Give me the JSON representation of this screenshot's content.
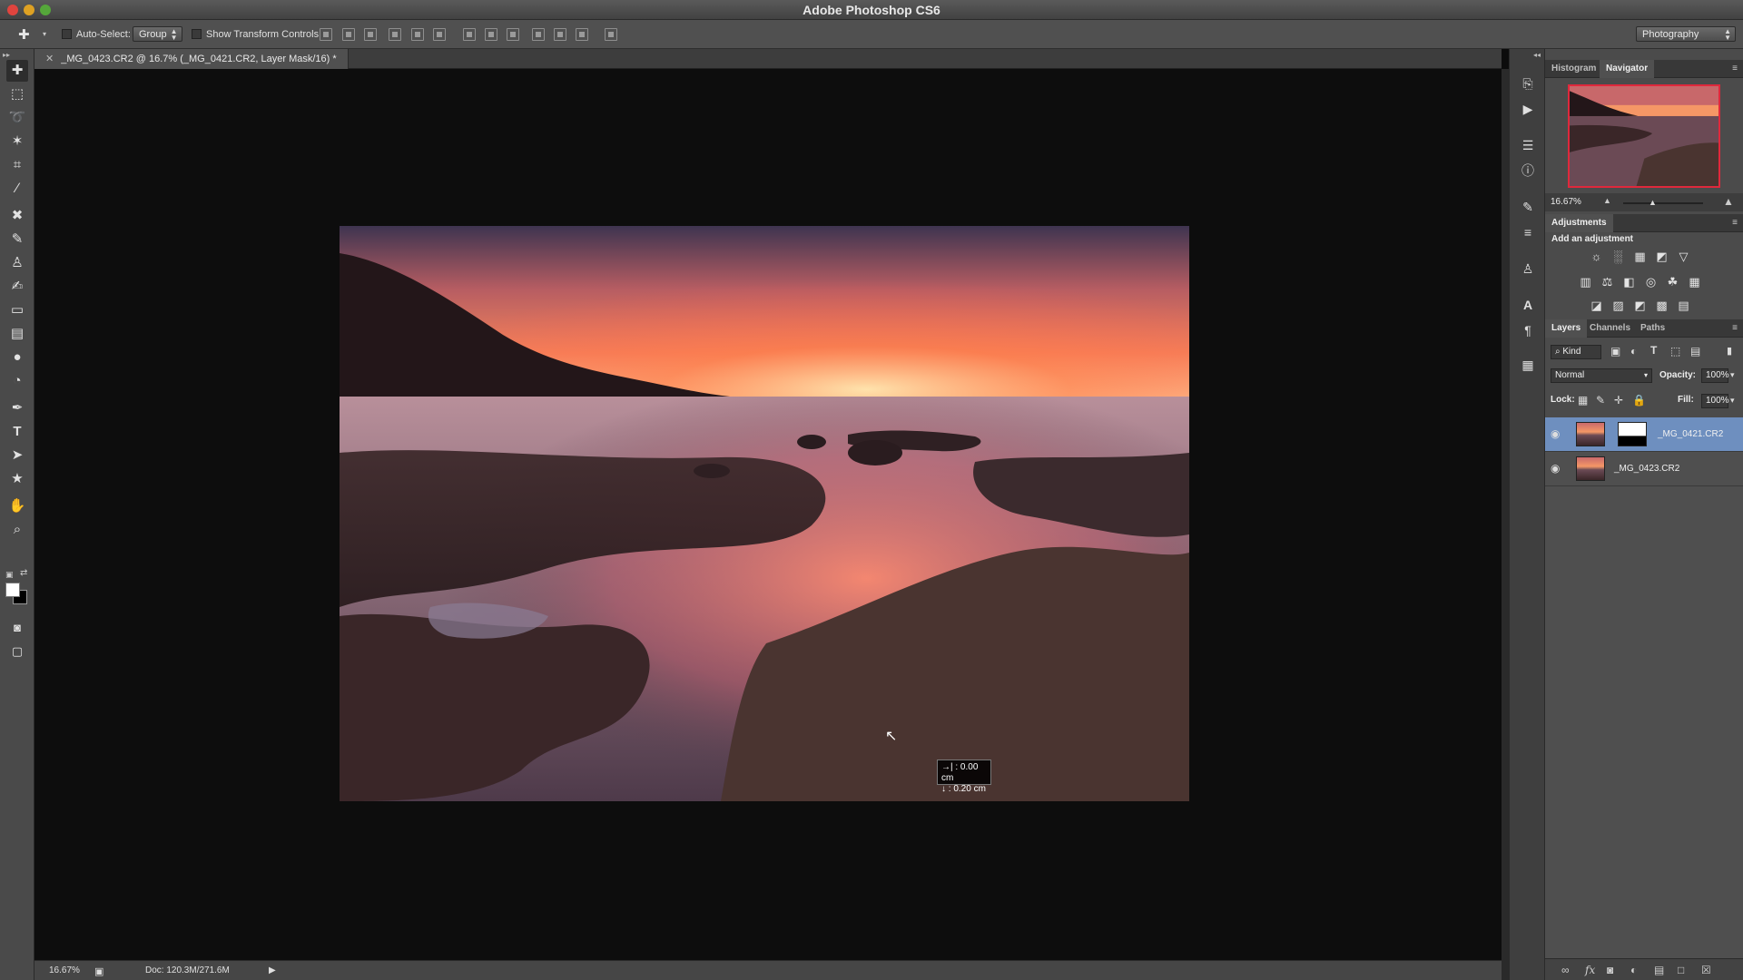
{
  "app": {
    "title": "Adobe Photoshop CS6"
  },
  "colors": {
    "accent_selected": "#6e8fbf",
    "panel": "#4b4b4b",
    "canvas": "#0d0d0d"
  },
  "options_bar": {
    "auto_select_label": "Auto-Select:",
    "auto_select_value": "Group",
    "show_transform_label": "Show Transform Controls",
    "workspace": "Photography"
  },
  "document": {
    "tab_label": "_MG_0423.CR2 @ 16.7% (_MG_0421.CR2, Layer Mask/16) *",
    "measure_x": "→| : 0.00 cm",
    "measure_y": "↓ : 0.20 cm"
  },
  "status_bar": {
    "zoom": "16.67%",
    "doc_size": "Doc: 120.3M/271.6M"
  },
  "tools": [
    "move-icon",
    "marquee-icon",
    "lasso-icon",
    "magic-wand-icon",
    "crop-icon",
    "eyedropper-icon",
    "healing-icon",
    "brush-icon",
    "stamp-icon",
    "history-brush-icon",
    "eraser-icon",
    "gradient-icon",
    "blur-icon",
    "dodge-icon",
    "pen-icon",
    "type-icon",
    "path-select-icon",
    "shape-icon",
    "hand-icon",
    "zoom-icon"
  ],
  "navigator": {
    "tab_histogram": "Histogram",
    "tab_navigator": "Navigator",
    "zoom": "16.67%"
  },
  "adjustments": {
    "tab": "Adjustments",
    "hint": "Add an adjustment"
  },
  "layers_panel": {
    "tab_layers": "Layers",
    "tab_channels": "Channels",
    "tab_paths": "Paths",
    "filter_kind": "Kind",
    "blend_mode": "Normal",
    "opacity_label": "Opacity:",
    "opacity_value": "100%",
    "lock_label": "Lock:",
    "fill_label": "Fill:",
    "fill_value": "100%",
    "layers": [
      {
        "name": "_MG_0421.CR2",
        "selected": true,
        "has_mask": true
      },
      {
        "name": "_MG_0423.CR2",
        "selected": false,
        "has_mask": false
      }
    ]
  }
}
